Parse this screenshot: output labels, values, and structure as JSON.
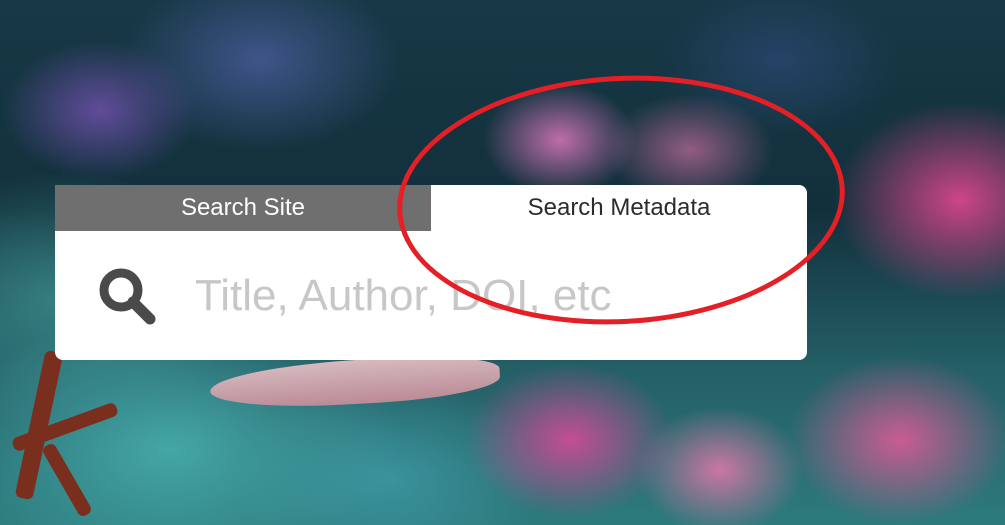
{
  "search_widget": {
    "tabs": [
      {
        "label": "Search Site",
        "active": false
      },
      {
        "label": "Search Metadata",
        "active": true
      }
    ],
    "input": {
      "value": "",
      "placeholder": "Title, Author, DOI, etc"
    },
    "icon": "search-icon"
  },
  "colors": {
    "tab_inactive_bg": "#6f6f6f",
    "tab_active_bg": "#ffffff",
    "placeholder_text": "#c7c7c7",
    "icon_color": "#4a4a4a",
    "highlight_ring": "#e41f26"
  }
}
